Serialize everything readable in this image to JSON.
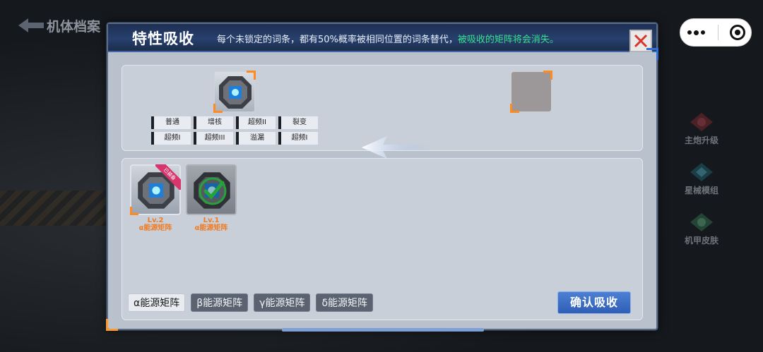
{
  "background": {
    "back_label": "机体档案",
    "right_menu": [
      {
        "label": "主炮升级",
        "icon": "cannon-upgrade-icon"
      },
      {
        "label": "星械模组",
        "icon": "star-module-icon"
      },
      {
        "label": "机甲皮肤",
        "icon": "mecha-skin-icon"
      }
    ]
  },
  "dialog": {
    "title": "特性吸收",
    "subtitle_main": "每个未锁定的词条，都有50%概率被相同位置的词条替代，",
    "subtitle_highlight": "被吸收的矩阵将会消失。",
    "traits": [
      "普通",
      "增核",
      "超频II",
      "裂变",
      "超频I",
      "超频III",
      "溢漏",
      "超频I"
    ],
    "items": [
      {
        "level": "Lv.2",
        "name": "α能源矩阵",
        "badge": "已装备",
        "selected": false
      },
      {
        "level": "Lv.1",
        "name": "α能源矩阵",
        "badge": "",
        "selected": true
      }
    ],
    "filters": [
      "α能源矩阵",
      "β能源矩阵",
      "γ能源矩阵",
      "δ能源矩阵"
    ],
    "active_filter": "α能源矩阵",
    "confirm_label": "确认吸收"
  },
  "colors": {
    "accent_orange": "#ff8a1f",
    "highlight_green": "#37e08e",
    "confirm_blue": "#2f5fb4",
    "titlebar_blue": "#27406d"
  }
}
